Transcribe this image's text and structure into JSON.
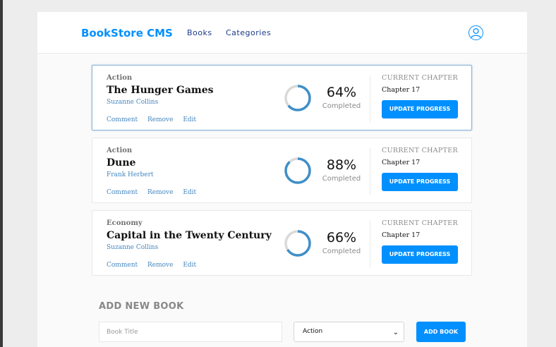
{
  "header": {
    "brand": "BookStore CMS",
    "nav": [
      "Books",
      "Categories"
    ],
    "user_icon": "user-circle-icon"
  },
  "books": [
    {
      "category": "Action",
      "title": "The Hunger Games",
      "author": "Suzanne Collins",
      "actions": [
        "Comment",
        "Remove",
        "Edit"
      ],
      "progress": 0.64,
      "percent_label": "64%",
      "completed_label": "Completed",
      "current_chapter_label": "CURRENT CHAPTER",
      "chapter": "Chapter 17",
      "update_label": "UPDATE PROGRESS"
    },
    {
      "category": "Action",
      "title": "Dune",
      "author": "Frank Herbert",
      "actions": [
        "Comment",
        "Remove",
        "Edit"
      ],
      "progress": 0.88,
      "percent_label": "88%",
      "completed_label": "Completed",
      "current_chapter_label": "CURRENT CHAPTER",
      "chapter": "Chapter 17",
      "update_label": "UPDATE PROGRESS"
    },
    {
      "category": "Economy",
      "title": "Capital in the Twenty Century",
      "author": "Suzanne Collins",
      "actions": [
        "Comment",
        "Remove",
        "Edit"
      ],
      "progress": 0.66,
      "percent_label": "66%",
      "completed_label": "Completed",
      "current_chapter_label": "CURRENT CHAPTER",
      "chapter": "Chapter 17",
      "update_label": "UPDATE PROGRESS"
    }
  ],
  "add_form": {
    "heading": "ADD NEW BOOK",
    "title_placeholder": "Book Title",
    "category_value": "Action",
    "submit_label": "ADD BOOK"
  },
  "colors": {
    "accent": "#0290ff",
    "ring_fill": "#3f8fc8",
    "ring_track": "#d9d9d9",
    "link": "#4386bf"
  }
}
